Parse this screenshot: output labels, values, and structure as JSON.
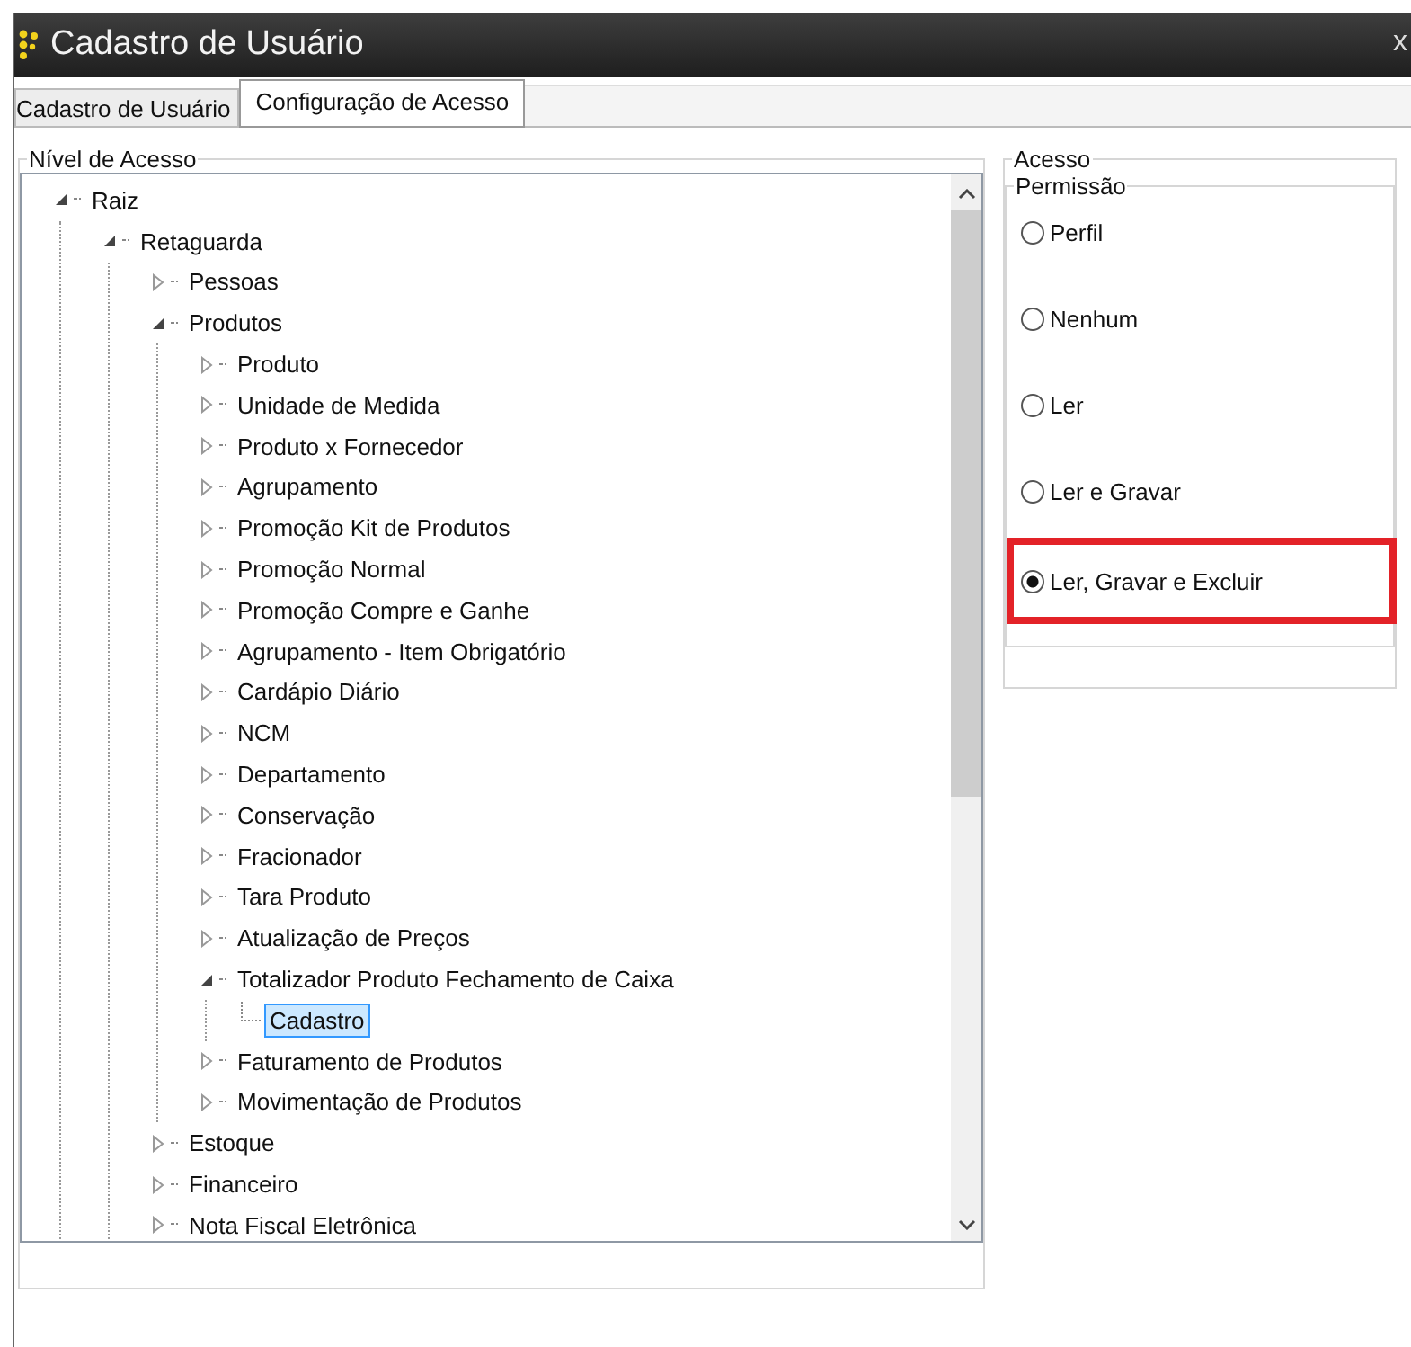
{
  "window": {
    "title": "Cadastro de Usuário",
    "close": "x"
  },
  "tabs": [
    {
      "label": "Cadastro de Usuário",
      "selected": false
    },
    {
      "label": "Configuração de Acesso",
      "selected": true
    }
  ],
  "access_level": {
    "title": "Nível de Acesso",
    "tree": [
      {
        "label": "Raiz",
        "expanded": true,
        "children": [
          {
            "label": "Retaguarda",
            "expanded": true,
            "children": [
              {
                "label": "Pessoas",
                "expanded": false
              },
              {
                "label": "Produtos",
                "expanded": true,
                "children": [
                  {
                    "label": "Produto",
                    "expanded": false
                  },
                  {
                    "label": "Unidade de Medida",
                    "expanded": false
                  },
                  {
                    "label": "Produto x Fornecedor",
                    "expanded": false
                  },
                  {
                    "label": "Agrupamento",
                    "expanded": false
                  },
                  {
                    "label": "Promoção Kit de Produtos",
                    "expanded": false
                  },
                  {
                    "label": "Promoção Normal",
                    "expanded": false
                  },
                  {
                    "label": "Promoção Compre e Ganhe",
                    "expanded": false
                  },
                  {
                    "label": "Agrupamento - Item Obrigatório",
                    "expanded": false
                  },
                  {
                    "label": "Cardápio Diário",
                    "expanded": false
                  },
                  {
                    "label": "NCM",
                    "expanded": false
                  },
                  {
                    "label": "Departamento",
                    "expanded": false
                  },
                  {
                    "label": "Conservação",
                    "expanded": false
                  },
                  {
                    "label": "Fracionador",
                    "expanded": false
                  },
                  {
                    "label": "Tara Produto",
                    "expanded": false
                  },
                  {
                    "label": "Atualização de Preços",
                    "expanded": false
                  },
                  {
                    "label": "Totalizador Produto Fechamento de Caixa",
                    "expanded": true,
                    "children": [
                      {
                        "label": "Cadastro",
                        "selected": true
                      }
                    ]
                  },
                  {
                    "label": "Faturamento de Produtos",
                    "expanded": false
                  },
                  {
                    "label": "Movimentação de Produtos",
                    "expanded": false
                  }
                ]
              },
              {
                "label": "Estoque",
                "expanded": false
              },
              {
                "label": "Financeiro",
                "expanded": false
              },
              {
                "label": "Nota Fiscal Eletrônica",
                "expanded": false
              }
            ]
          }
        ]
      }
    ]
  },
  "access": {
    "title": "Acesso",
    "permission": {
      "title": "Permissão",
      "options": [
        {
          "label": "Perfil",
          "selected": false,
          "highlighted": false
        },
        {
          "label": "Nenhum",
          "selected": false,
          "highlighted": false
        },
        {
          "label": "Ler",
          "selected": false,
          "highlighted": false
        },
        {
          "label": "Ler e Gravar",
          "selected": false,
          "highlighted": false
        },
        {
          "label": "Ler, Gravar e Excluir",
          "selected": true,
          "highlighted": true
        }
      ]
    }
  }
}
